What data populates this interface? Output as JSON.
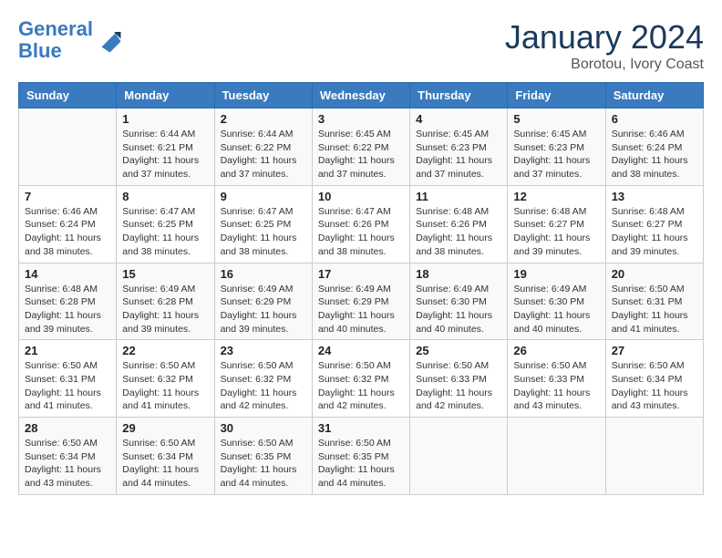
{
  "header": {
    "logo_line1": "General",
    "logo_line2": "Blue",
    "month": "January 2024",
    "location": "Borotou, Ivory Coast"
  },
  "columns": [
    "Sunday",
    "Monday",
    "Tuesday",
    "Wednesday",
    "Thursday",
    "Friday",
    "Saturday"
  ],
  "weeks": [
    [
      {
        "day": "",
        "text": ""
      },
      {
        "day": "1",
        "text": "Sunrise: 6:44 AM\nSunset: 6:21 PM\nDaylight: 11 hours and 37 minutes."
      },
      {
        "day": "2",
        "text": "Sunrise: 6:44 AM\nSunset: 6:22 PM\nDaylight: 11 hours and 37 minutes."
      },
      {
        "day": "3",
        "text": "Sunrise: 6:45 AM\nSunset: 6:22 PM\nDaylight: 11 hours and 37 minutes."
      },
      {
        "day": "4",
        "text": "Sunrise: 6:45 AM\nSunset: 6:23 PM\nDaylight: 11 hours and 37 minutes."
      },
      {
        "day": "5",
        "text": "Sunrise: 6:45 AM\nSunset: 6:23 PM\nDaylight: 11 hours and 37 minutes."
      },
      {
        "day": "6",
        "text": "Sunrise: 6:46 AM\nSunset: 6:24 PM\nDaylight: 11 hours and 38 minutes."
      }
    ],
    [
      {
        "day": "7",
        "text": "Sunrise: 6:46 AM\nSunset: 6:24 PM\nDaylight: 11 hours and 38 minutes."
      },
      {
        "day": "8",
        "text": "Sunrise: 6:47 AM\nSunset: 6:25 PM\nDaylight: 11 hours and 38 minutes."
      },
      {
        "day": "9",
        "text": "Sunrise: 6:47 AM\nSunset: 6:25 PM\nDaylight: 11 hours and 38 minutes."
      },
      {
        "day": "10",
        "text": "Sunrise: 6:47 AM\nSunset: 6:26 PM\nDaylight: 11 hours and 38 minutes."
      },
      {
        "day": "11",
        "text": "Sunrise: 6:48 AM\nSunset: 6:26 PM\nDaylight: 11 hours and 38 minutes."
      },
      {
        "day": "12",
        "text": "Sunrise: 6:48 AM\nSunset: 6:27 PM\nDaylight: 11 hours and 39 minutes."
      },
      {
        "day": "13",
        "text": "Sunrise: 6:48 AM\nSunset: 6:27 PM\nDaylight: 11 hours and 39 minutes."
      }
    ],
    [
      {
        "day": "14",
        "text": "Sunrise: 6:48 AM\nSunset: 6:28 PM\nDaylight: 11 hours and 39 minutes."
      },
      {
        "day": "15",
        "text": "Sunrise: 6:49 AM\nSunset: 6:28 PM\nDaylight: 11 hours and 39 minutes."
      },
      {
        "day": "16",
        "text": "Sunrise: 6:49 AM\nSunset: 6:29 PM\nDaylight: 11 hours and 39 minutes."
      },
      {
        "day": "17",
        "text": "Sunrise: 6:49 AM\nSunset: 6:29 PM\nDaylight: 11 hours and 40 minutes."
      },
      {
        "day": "18",
        "text": "Sunrise: 6:49 AM\nSunset: 6:30 PM\nDaylight: 11 hours and 40 minutes."
      },
      {
        "day": "19",
        "text": "Sunrise: 6:49 AM\nSunset: 6:30 PM\nDaylight: 11 hours and 40 minutes."
      },
      {
        "day": "20",
        "text": "Sunrise: 6:50 AM\nSunset: 6:31 PM\nDaylight: 11 hours and 41 minutes."
      }
    ],
    [
      {
        "day": "21",
        "text": "Sunrise: 6:50 AM\nSunset: 6:31 PM\nDaylight: 11 hours and 41 minutes."
      },
      {
        "day": "22",
        "text": "Sunrise: 6:50 AM\nSunset: 6:32 PM\nDaylight: 11 hours and 41 minutes."
      },
      {
        "day": "23",
        "text": "Sunrise: 6:50 AM\nSunset: 6:32 PM\nDaylight: 11 hours and 42 minutes."
      },
      {
        "day": "24",
        "text": "Sunrise: 6:50 AM\nSunset: 6:32 PM\nDaylight: 11 hours and 42 minutes."
      },
      {
        "day": "25",
        "text": "Sunrise: 6:50 AM\nSunset: 6:33 PM\nDaylight: 11 hours and 42 minutes."
      },
      {
        "day": "26",
        "text": "Sunrise: 6:50 AM\nSunset: 6:33 PM\nDaylight: 11 hours and 43 minutes."
      },
      {
        "day": "27",
        "text": "Sunrise: 6:50 AM\nSunset: 6:34 PM\nDaylight: 11 hours and 43 minutes."
      }
    ],
    [
      {
        "day": "28",
        "text": "Sunrise: 6:50 AM\nSunset: 6:34 PM\nDaylight: 11 hours and 43 minutes."
      },
      {
        "day": "29",
        "text": "Sunrise: 6:50 AM\nSunset: 6:34 PM\nDaylight: 11 hours and 44 minutes."
      },
      {
        "day": "30",
        "text": "Sunrise: 6:50 AM\nSunset: 6:35 PM\nDaylight: 11 hours and 44 minutes."
      },
      {
        "day": "31",
        "text": "Sunrise: 6:50 AM\nSunset: 6:35 PM\nDaylight: 11 hours and 44 minutes."
      },
      {
        "day": "",
        "text": ""
      },
      {
        "day": "",
        "text": ""
      },
      {
        "day": "",
        "text": ""
      }
    ]
  ]
}
